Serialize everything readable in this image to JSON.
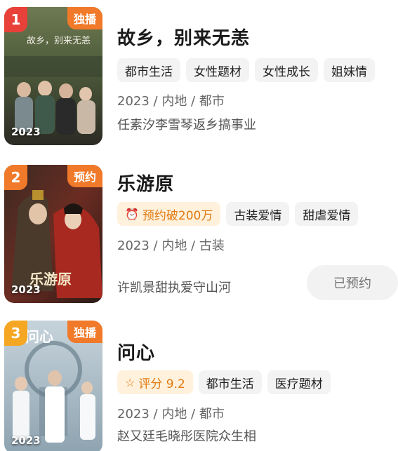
{
  "items": [
    {
      "rank": "1",
      "badge": "独播",
      "year": "2023",
      "title": "故乡，别来无恙",
      "poster_caption": "故乡，别来无恙",
      "tags": [
        "都市生活",
        "女性题材",
        "女性成长",
        "姐妹情"
      ],
      "meta": "2023 / 内地 / 都市",
      "desc": "任素汐李雪琴返乡搞事业",
      "rank_color": "#e8413a"
    },
    {
      "rank": "2",
      "badge": "预约",
      "year": "2023",
      "title": "乐游原",
      "poster_caption": "乐游原",
      "highlight": {
        "icon": "alarm-clock-icon",
        "text": "预约破200万"
      },
      "tags": [
        "古装爱情",
        "甜虐爱情"
      ],
      "meta": "2023 / 内地 / 古装",
      "desc": "许凯景甜执爱守山河",
      "reserve_label": "已预约",
      "rank_color": "#f07a2a"
    },
    {
      "rank": "3",
      "badge": "独播",
      "year": "2023",
      "title": "问心",
      "poster_caption": "问心",
      "highlight": {
        "icon": "star-icon",
        "text": "评分 9.2"
      },
      "tags": [
        "都市生活",
        "医疗题材"
      ],
      "meta": "2023 / 内地 / 都市",
      "desc": "赵又廷毛晓彤医院众生相",
      "rank_color": "#f5a623"
    }
  ]
}
